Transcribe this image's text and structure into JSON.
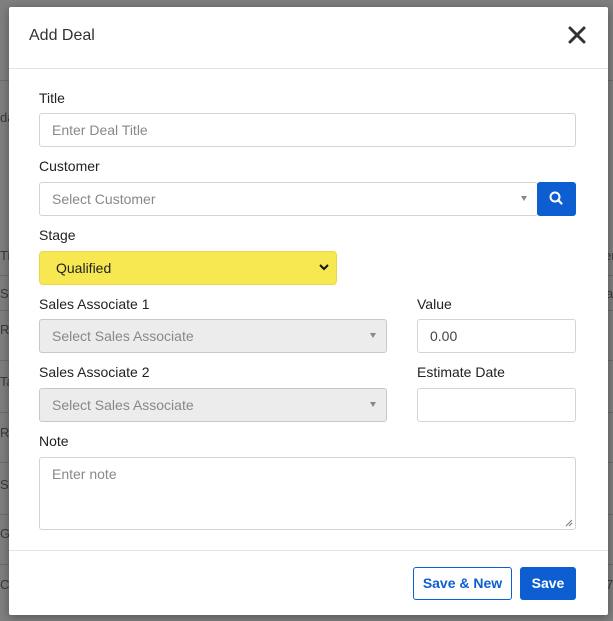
{
  "background": {
    "fragments": [
      "da",
      "Ti",
      "S",
      "Ro",
      "Ta",
      "Ri",
      "Sy",
      "Ge",
      "Ca",
      "er",
      "a",
      "7"
    ]
  },
  "modal": {
    "title": "Add Deal",
    "close_icon": "close-icon"
  },
  "form": {
    "title": {
      "label": "Title",
      "placeholder": "Enter Deal Title"
    },
    "customer": {
      "label": "Customer",
      "placeholder": "Select Customer",
      "search_icon": "search-icon"
    },
    "stage": {
      "label": "Stage",
      "value": "Qualified",
      "color": "#f7e851"
    },
    "sales_associate_1": {
      "label": "Sales Associate 1",
      "placeholder": "Select Sales Associate"
    },
    "sales_associate_2": {
      "label": "Sales Associate 2",
      "placeholder": "Select Sales Associate"
    },
    "value": {
      "label": "Value",
      "value": "0.00"
    },
    "estimate_date": {
      "label": "Estimate Date",
      "value": ""
    },
    "note": {
      "label": "Note",
      "placeholder": "Enter note"
    }
  },
  "footer": {
    "save_new_label": "Save & New",
    "save_label": "Save",
    "accent": "#0d5fd1"
  }
}
